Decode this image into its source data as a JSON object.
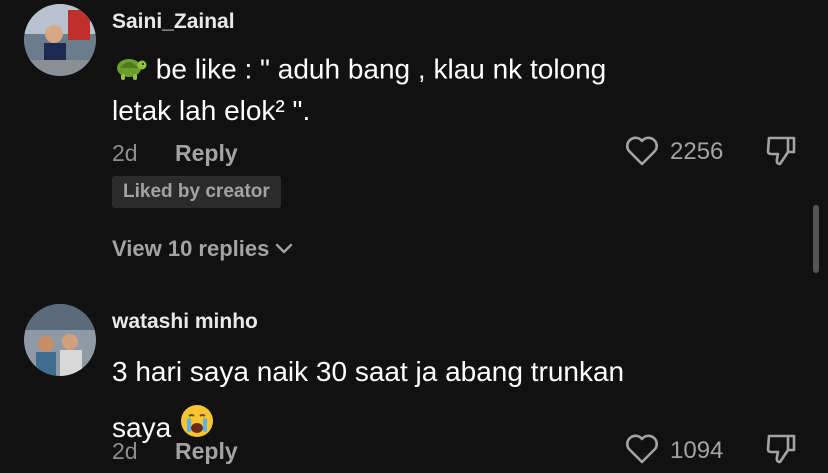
{
  "comments": [
    {
      "username": "Saini_Zainal",
      "text_line1": " be like : \" aduh bang , klau nk tolong",
      "text_line2": "letak lah elok² \".",
      "emoji": "turtle-emoji",
      "age": "2d",
      "reply_label": "Reply",
      "like_count": "2256",
      "liked_badge": "Liked by creator",
      "view_replies": "View 10 replies"
    },
    {
      "username": "watashi minho",
      "text_line1": "3 hari saya naik 30 saat ja abang trunkan",
      "text_line2": "saya",
      "emoji": "crying-face-emoji",
      "age": "2d",
      "reply_label": "Reply",
      "like_count": "1094"
    }
  ],
  "colors": {
    "background": "#111111",
    "text": "#ffffff",
    "muted": "#a3a3a3",
    "badge": "#2b2b2b"
  }
}
